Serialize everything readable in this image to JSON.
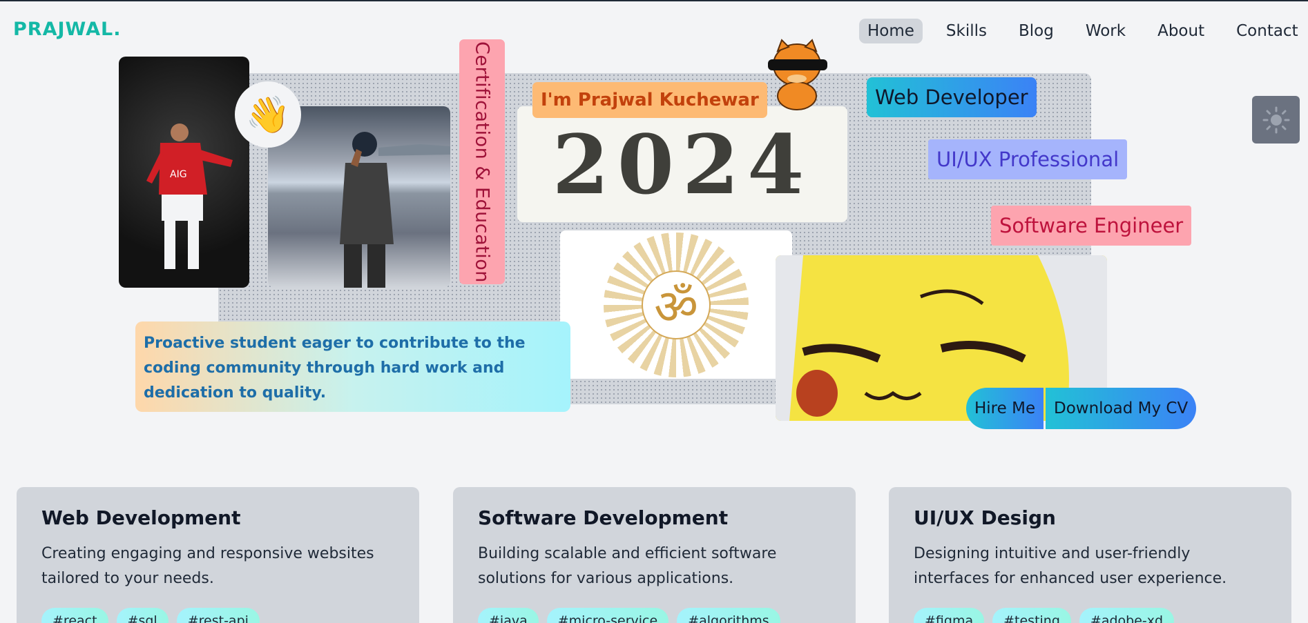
{
  "header": {
    "logo": "PRAJWAL.",
    "nav": [
      {
        "label": "Home",
        "active": true
      },
      {
        "label": "Skills"
      },
      {
        "label": "Blog"
      },
      {
        "label": "Work"
      },
      {
        "label": "About"
      },
      {
        "label": "Contact"
      }
    ]
  },
  "hero": {
    "certification_label": "Certification & Education",
    "name_badge": "I'm Prajwal Kuchewar",
    "year": "2024",
    "roles": [
      "Web Developer",
      "UI/UX Professional",
      "Software Engineer"
    ],
    "bio": "Proactive student eager to contribute to the coding community through hard work and dedication to quality.",
    "wave_icon": "👋",
    "om_symbol": "ॐ",
    "buttons": {
      "hire": "Hire Me",
      "cv": "Download My CV"
    }
  },
  "theme_toggle": {
    "icon": "sun-icon"
  },
  "services": [
    {
      "title": "Web Development",
      "description": "Creating engaging and responsive websites tailored to your needs.",
      "tags": [
        "#react",
        "#sql",
        "#rest-api"
      ]
    },
    {
      "title": "Software Development",
      "description": "Building scalable and efficient software solutions for various applications.",
      "tags": [
        "#java",
        "#micro-service",
        "#algorithms"
      ]
    },
    {
      "title": "UI/UX Design",
      "description": "Designing intuitive and user-friendly interfaces for enhanced user experience.",
      "tags": [
        "#figma",
        "#testing",
        "#adobe-xd"
      ]
    }
  ],
  "colors": {
    "accent": "#14b8a6",
    "background": "#f3f4f6",
    "card": "#d1d5db"
  }
}
